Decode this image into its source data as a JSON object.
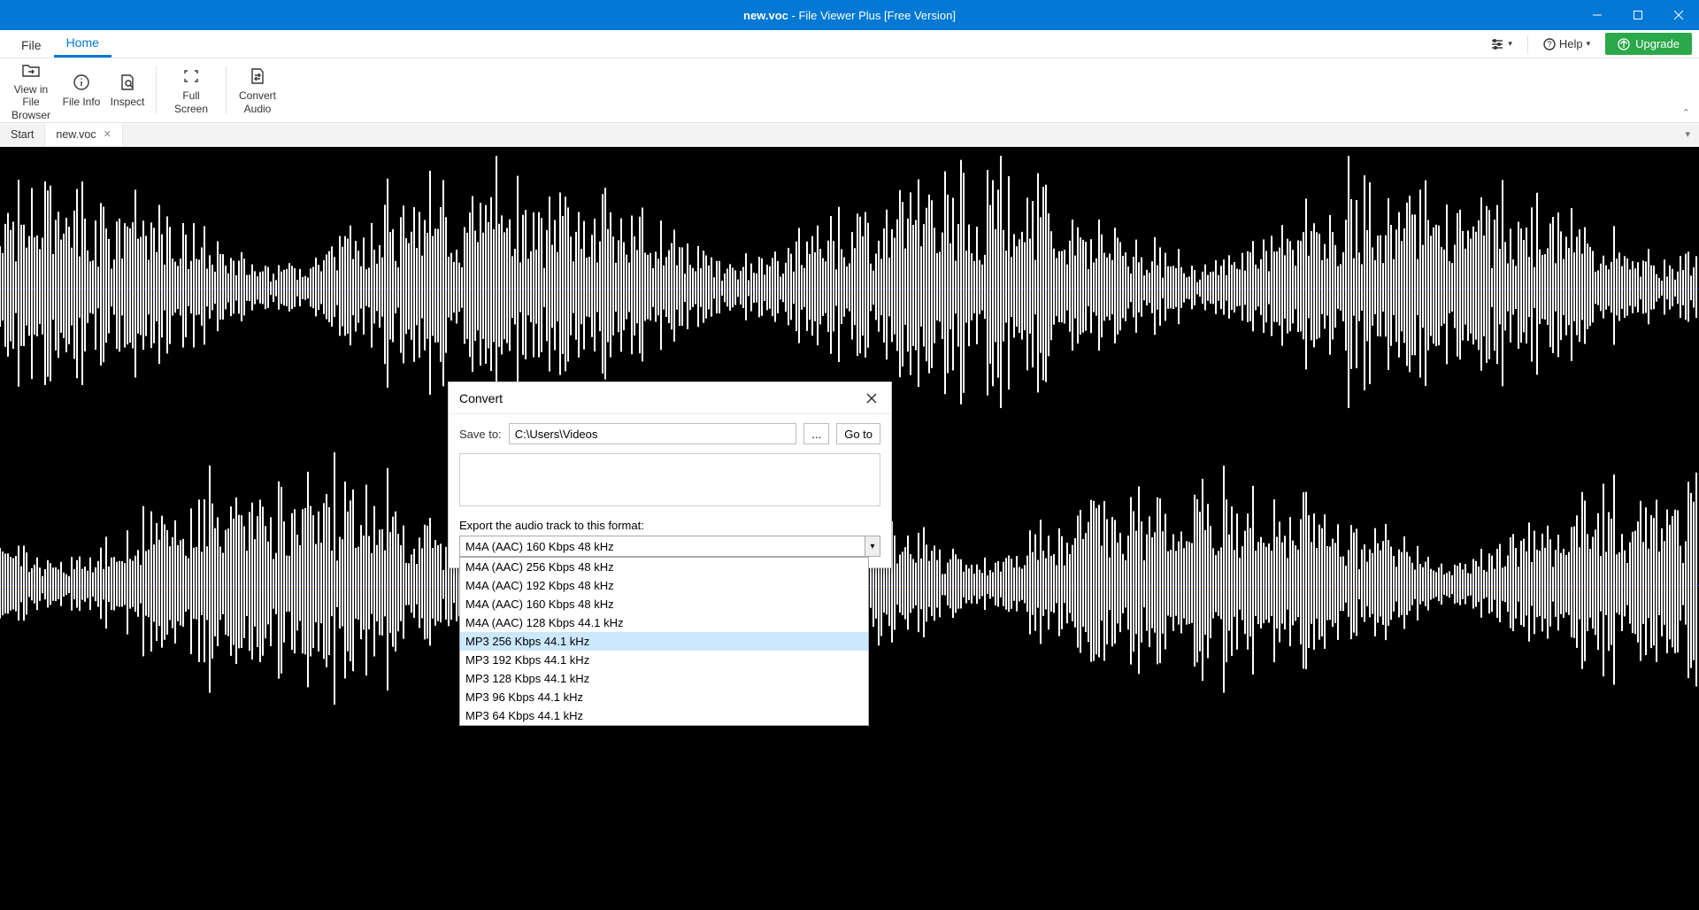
{
  "titlebar": {
    "filename": "new.voc",
    "app": "File Viewer Plus [Free Version]"
  },
  "menubar": {
    "file": "File",
    "home": "Home",
    "help": "Help",
    "upgrade": "Upgrade"
  },
  "ribbon": {
    "view_in_browser": "View in File Browser",
    "file_info": "File Info",
    "inspect": "Inspect",
    "full_screen": "Full Screen",
    "convert_audio": "Convert Audio"
  },
  "tabs": {
    "start": "Start",
    "file": "new.voc"
  },
  "dialog": {
    "title": "Convert",
    "save_to_label": "Save to:",
    "save_to_path": "C:\\Users\\Videos",
    "browse": "...",
    "go_to": "Go to",
    "export_label": "Export the audio track to this format:",
    "selected": "M4A (AAC) 160 Kbps 48 kHz",
    "options": [
      "M4A (AAC) 256 Kbps 48 kHz",
      "M4A (AAC) 192 Kbps 48 kHz",
      "M4A (AAC) 160 Kbps 48 kHz",
      "M4A (AAC) 128 Kbps 44.1 kHz",
      "MP3 256 Kbps 44.1 kHz",
      "MP3 192 Kbps 44.1 kHz",
      "MP3 128 Kbps 44.1 kHz",
      "MP3 96 Kbps 44.1 kHz",
      "MP3 64 Kbps 44.1 kHz"
    ],
    "highlight_index": 4
  }
}
